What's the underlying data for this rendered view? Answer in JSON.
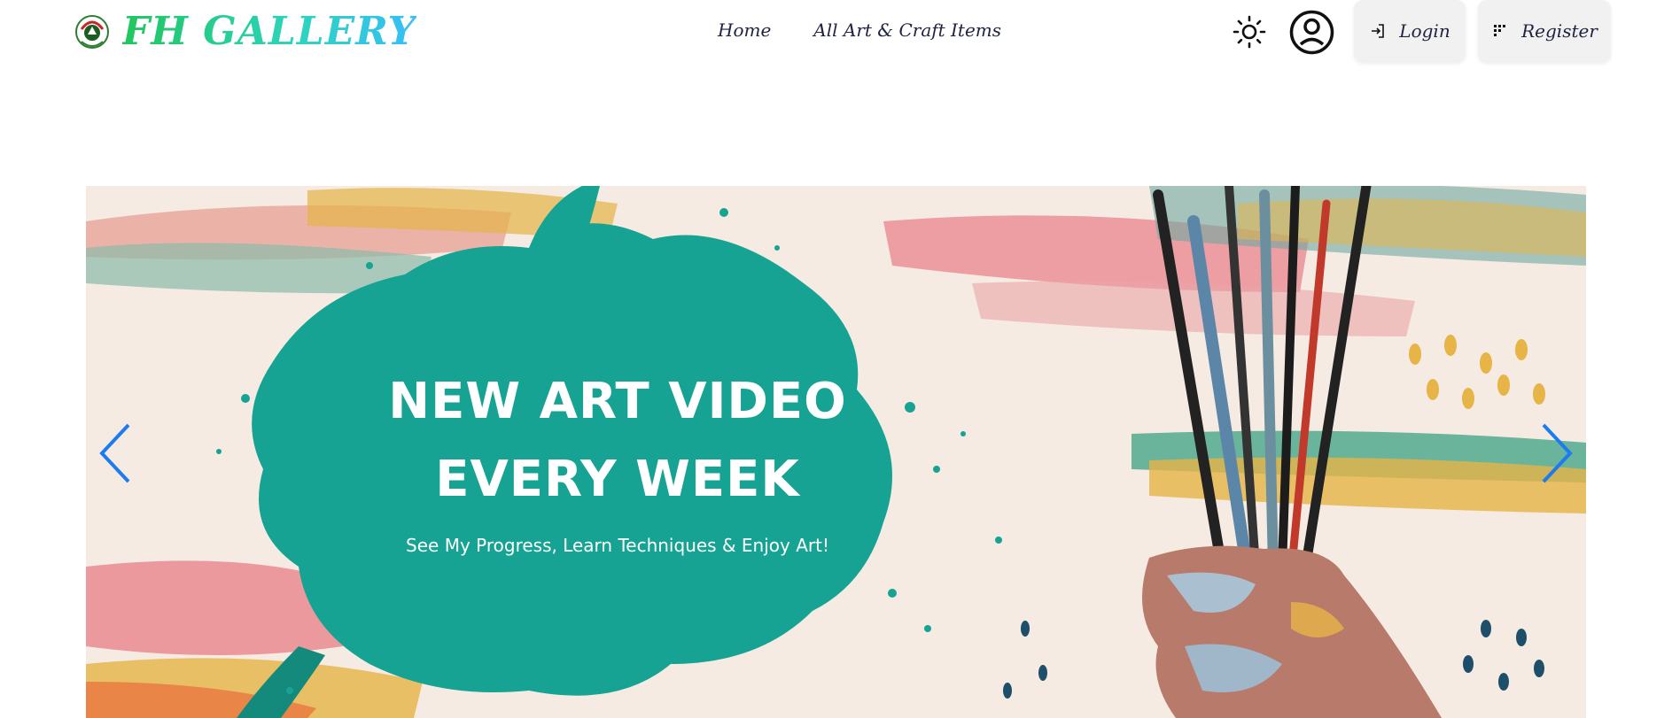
{
  "brand": {
    "name": "FH GALLERY",
    "logo_icon": "fh-gallery-logo"
  },
  "nav": {
    "links": [
      {
        "label": "Home"
      },
      {
        "label": "All Art & Craft Items"
      }
    ]
  },
  "header_actions": {
    "theme_toggle_icon": "sun-icon",
    "avatar_icon": "user-circle-icon",
    "login_label": "Login",
    "login_icon": "login-arrow-icon",
    "register_label": "Register",
    "register_icon": "register-grid-icon"
  },
  "carousel": {
    "slide": {
      "title_line1": "NEW ART VIDEO",
      "title_line2": "EVERY WEEK",
      "subtitle": "See My Progress, Learn Techniques & Enjoy Art!"
    },
    "prev_icon": "chevron-left-icon",
    "next_icon": "chevron-right-icon"
  },
  "colors": {
    "brand_gradient_start": "#22c55e",
    "brand_gradient_end": "#38bdf8",
    "carousel_arrow": "#1d7bf0",
    "hero_splash": "#16a394",
    "button_bg": "#f1f1f1",
    "nav_text": "#1f2340"
  }
}
